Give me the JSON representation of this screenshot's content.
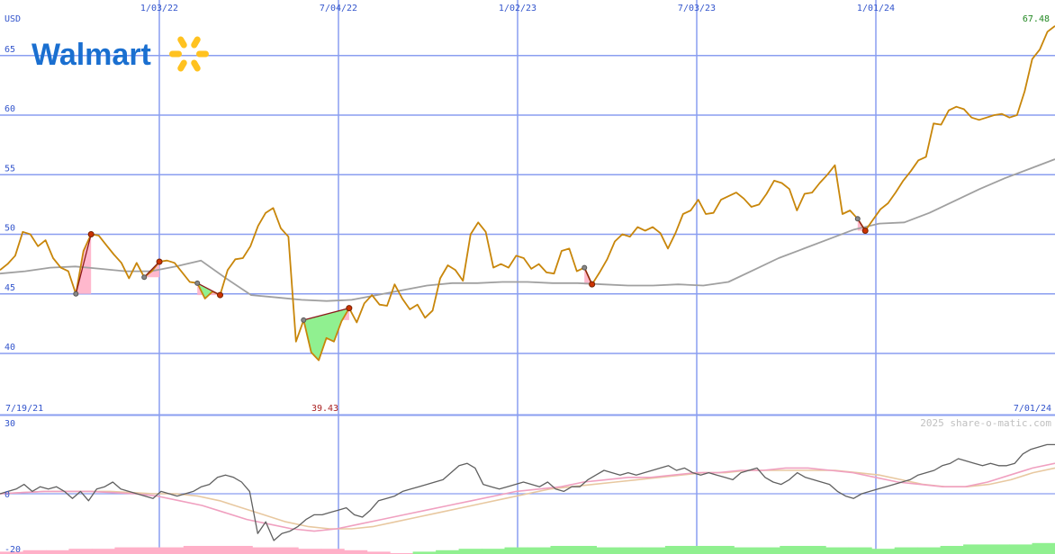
{
  "colors": {
    "price": "#c8860a",
    "ma": "#a0a0a0",
    "grid": "#8a9ef0",
    "tick_text": "#3355cc",
    "last_value": "#228822",
    "low_value": "#aa2222",
    "brand_blue": "#1a6fd0",
    "brand_yellow": "#ffc220",
    "rise_fill": "#ffb0c8",
    "fall_fill": "#90f090",
    "ind_dark": "#606060",
    "ind_pink": "#f0a0c0",
    "ind_tan": "#e8c8a0"
  },
  "header": {
    "currency": "USD",
    "last_price": "67.48",
    "low_price": "39.43",
    "start_date": "7/19/21",
    "end_date": "7/01/24",
    "credit": "2025 share-o-matic.com"
  },
  "brand": {
    "name": "Walmart",
    "logo_icon": "spark-icon"
  },
  "chart_data": {
    "type": "line",
    "x_tick_labels": [
      "1/03/22",
      "7/04/22",
      "1/02/23",
      "7/03/23",
      "1/01/24"
    ],
    "price_panel": {
      "ylim": [
        36,
        69
      ],
      "yticks": [
        40,
        45,
        50,
        55,
        60,
        65
      ],
      "grid": true
    },
    "indicator_panel": {
      "ylim": [
        -20,
        30
      ],
      "yticks": [
        30,
        0,
        -20
      ],
      "grid": true
    },
    "series": [
      {
        "role": "price",
        "values": [
          47.0,
          47.5,
          48.2,
          50.2,
          50.0,
          49.0,
          49.5,
          48.0,
          47.2,
          46.9,
          45.0,
          48.6,
          50.0,
          49.9,
          49.1,
          48.3,
          47.6,
          46.3,
          47.6,
          46.4,
          46.9,
          47.7,
          47.8,
          47.6,
          46.8,
          46.0,
          45.9,
          44.6,
          45.2,
          44.9,
          47.0,
          47.9,
          48.0,
          49.0,
          50.7,
          51.8,
          52.2,
          50.5,
          49.8,
          41.0,
          42.8,
          40.1,
          39.43,
          41.3,
          41.0,
          42.7,
          43.8,
          42.6,
          44.2,
          44.9,
          44.1,
          44.0,
          45.8,
          44.6,
          43.7,
          44.1,
          43.0,
          43.6,
          46.3,
          47.4,
          47.0,
          46.1,
          50.0,
          51.0,
          50.2,
          47.2,
          47.5,
          47.2,
          48.2,
          48.0,
          47.1,
          47.5,
          46.8,
          46.7,
          48.6,
          48.8,
          46.9,
          47.2,
          45.8,
          46.8,
          47.9,
          49.4,
          50.0,
          49.8,
          50.6,
          50.3,
          50.6,
          50.1,
          48.8,
          50.1,
          51.7,
          52.0,
          52.9,
          51.7,
          51.8,
          52.9,
          53.2,
          53.5,
          53.0,
          52.3,
          52.5,
          53.4,
          54.5,
          54.3,
          53.8,
          52.0,
          53.4,
          53.5,
          54.3,
          55.0,
          55.8,
          51.7,
          52.0,
          51.3,
          50.3,
          51.2,
          52.1,
          52.6,
          53.5,
          54.5,
          55.3,
          56.2,
          56.5,
          59.3,
          59.2,
          60.4,
          60.7,
          60.5,
          59.8,
          59.6,
          59.8,
          60.0,
          60.1,
          59.8,
          60.0,
          62.0,
          64.7,
          65.5,
          67.0,
          67.48
        ],
        "x_range": [
          "7/19/21",
          "7/01/24"
        ]
      },
      {
        "role": "moving-average",
        "values": [
          46.7,
          46.9,
          47.2,
          47.3,
          47.1,
          46.9,
          46.9,
          47.3,
          47.8,
          46.3,
          44.9,
          44.7,
          44.5,
          44.4,
          44.5,
          44.9,
          45.3,
          45.7,
          45.9,
          45.9,
          46.0,
          46.0,
          45.9,
          45.9,
          45.8,
          45.7,
          45.7,
          45.8,
          45.7,
          46.0,
          47.0,
          48.0,
          48.8,
          49.6,
          50.4,
          50.9,
          51.0,
          51.8,
          52.8,
          53.8,
          54.7,
          55.5,
          56.3
        ],
        "x_range": [
          "7/19/21",
          "7/01/24"
        ]
      },
      {
        "role": "indicator-dark",
        "values": [
          0,
          1,
          2,
          4,
          1,
          3,
          2,
          3,
          1,
          -2,
          1,
          -3,
          2,
          3,
          5,
          2,
          1,
          0,
          -1,
          -2,
          1,
          0,
          -1,
          0,
          1,
          3,
          4,
          7,
          8,
          7,
          5,
          1,
          -17,
          -12,
          -20,
          -17,
          -16,
          -14,
          -11,
          -9,
          -9,
          -8,
          -7,
          -6,
          -9,
          -10,
          -7,
          -3,
          -2,
          -1,
          1,
          2,
          3,
          4,
          5,
          6,
          9,
          12,
          13,
          11,
          4,
          3,
          2,
          3,
          4,
          5,
          4,
          3,
          5,
          2,
          1,
          3,
          3,
          6,
          8,
          10,
          9,
          8,
          9,
          8,
          9,
          10,
          11,
          12,
          10,
          11,
          9,
          8,
          9,
          8,
          7,
          6,
          9,
          10,
          11,
          7,
          5,
          4,
          6,
          9,
          7,
          6,
          5,
          4,
          1,
          -1,
          -2,
          0,
          1,
          2,
          3,
          4,
          5,
          6,
          8,
          9,
          10,
          12,
          13,
          15,
          14,
          13,
          12,
          13,
          12,
          12,
          13,
          17,
          19,
          20,
          21,
          21
        ],
        "x_range": [
          "7/19/21",
          "7/01/24"
        ]
      },
      {
        "role": "indicator-pink",
        "values": [
          0,
          0.5,
          1,
          1,
          1,
          0.5,
          0,
          -1,
          -3,
          -5,
          -8,
          -11,
          -13,
          -15,
          -16,
          -15,
          -13,
          -11,
          -9,
          -7,
          -5,
          -3,
          -1,
          1,
          2,
          3,
          5,
          6,
          7,
          7,
          8,
          9,
          9,
          10,
          10,
          11,
          11,
          10,
          9,
          7,
          5,
          4,
          3,
          3,
          5,
          8,
          11,
          13
        ],
        "x_range": [
          "7/19/21",
          "7/01/24"
        ]
      },
      {
        "role": "indicator-tan",
        "values": [
          0,
          0.5,
          1,
          1,
          1,
          1,
          0.5,
          0,
          0,
          -1,
          -3,
          -6,
          -9,
          -12,
          -14,
          -15,
          -15,
          -14,
          -12,
          -10,
          -8,
          -6,
          -4,
          -2,
          0,
          2,
          3,
          4,
          5,
          6,
          7,
          8,
          9,
          9,
          10,
          10,
          10,
          10,
          10,
          9,
          8,
          6,
          4,
          3,
          3,
          4,
          6,
          9,
          11
        ],
        "x_range": [
          "7/19/21",
          "7/01/24"
        ]
      },
      {
        "role": "volume-histogram",
        "values": [
          1,
          2,
          2,
          3,
          3,
          4,
          4,
          4,
          5,
          5,
          5,
          4,
          4,
          3,
          3,
          2,
          1,
          0,
          -1,
          -2,
          -3,
          -3,
          -4,
          -4,
          -5,
          -5,
          -4,
          -4,
          -4,
          -5,
          -5,
          -5,
          -4,
          -4,
          -5,
          -5,
          -4,
          -4,
          -3,
          -4,
          -4,
          -5,
          -6,
          -6,
          -6,
          -7
        ],
        "x_range": [
          "7/19/21",
          "7/01/24"
        ]
      }
    ]
  }
}
